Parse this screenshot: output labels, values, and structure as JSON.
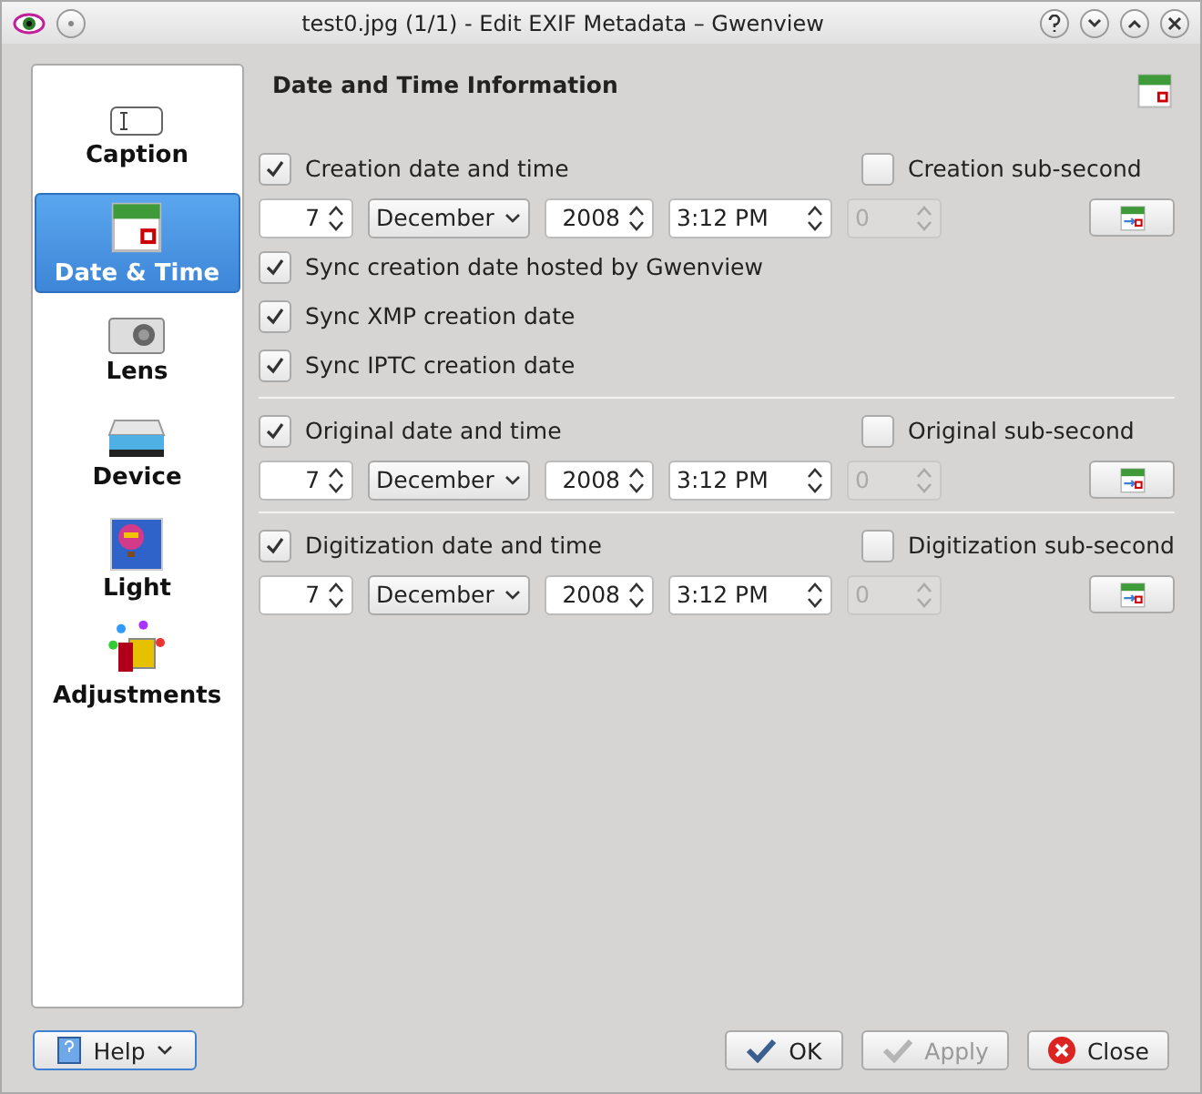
{
  "window": {
    "title": "test0.jpg (1/1) - Edit EXIF Metadata – Gwenview"
  },
  "sidebar": {
    "items": [
      {
        "label": "Caption",
        "selected": false
      },
      {
        "label": "Date & Time",
        "selected": true
      },
      {
        "label": "Lens",
        "selected": false
      },
      {
        "label": "Device",
        "selected": false
      },
      {
        "label": "Light",
        "selected": false
      },
      {
        "label": "Adjustments",
        "selected": false
      }
    ]
  },
  "panel": {
    "title": "Date and Time Information",
    "sections": [
      {
        "label": "Creation date and time",
        "checked": true,
        "subsecond_label": "Creation sub-second",
        "subsecond_checked": false,
        "day": "7",
        "month": "December",
        "year": "2008",
        "time": "3:12 PM",
        "subsecond": "0",
        "subsecond_disabled": true,
        "sync": [
          {
            "label": "Sync creation date hosted by Gwenview",
            "checked": true
          },
          {
            "label": "Sync XMP creation date",
            "checked": true
          },
          {
            "label": "Sync IPTC creation date",
            "checked": true
          }
        ]
      },
      {
        "label": "Original date and time",
        "checked": true,
        "subsecond_label": "Original sub-second",
        "subsecond_checked": false,
        "day": "7",
        "month": "December",
        "year": "2008",
        "time": "3:12 PM",
        "subsecond": "0",
        "subsecond_disabled": true
      },
      {
        "label": "Digitization date and time",
        "checked": true,
        "subsecond_label": "Digitization sub-second",
        "subsecond_checked": false,
        "day": "7",
        "month": "December",
        "year": "2008",
        "time": "3:12 PM",
        "subsecond": "0",
        "subsecond_disabled": true
      }
    ]
  },
  "buttons": [
    {
      "label": "Help",
      "kind": "help",
      "disabled": false
    },
    {
      "label": "OK",
      "kind": "ok",
      "disabled": false
    },
    {
      "label": "Apply",
      "kind": "apply",
      "disabled": true
    },
    {
      "label": "Close",
      "kind": "close",
      "disabled": false
    }
  ]
}
